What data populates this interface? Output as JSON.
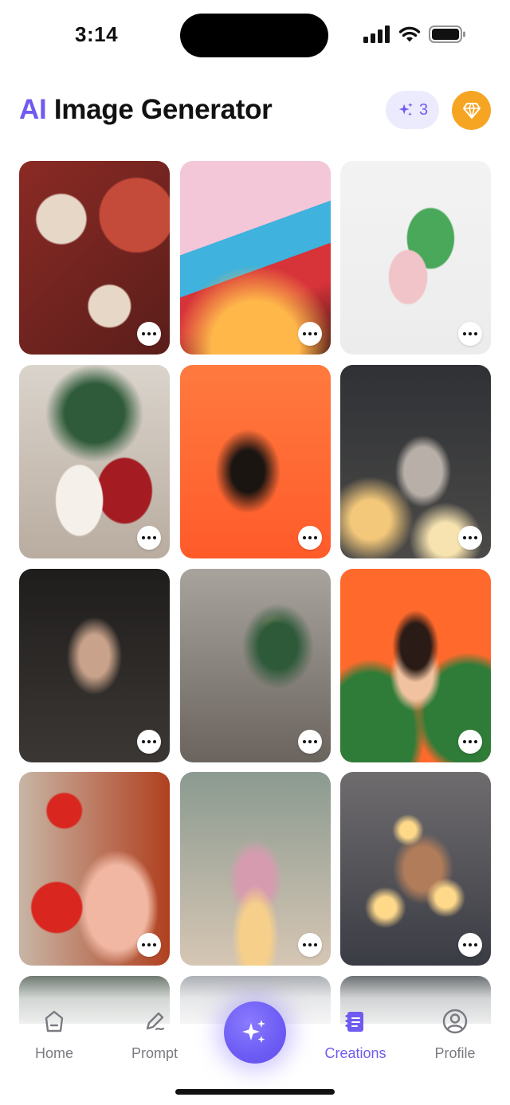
{
  "status_bar": {
    "time": "3:14"
  },
  "header": {
    "title_accent": "AI",
    "title_rest": " Image Generator",
    "credits": "3",
    "credit_icon": "sparkle-icon",
    "premium_icon": "diamond-icon"
  },
  "colors": {
    "accent": "#6f5bf0",
    "premium": "#f6a523",
    "credits_bg": "#ecebfd"
  },
  "grid": {
    "more_icon": "more-horizontal-icon",
    "tiles": [
      {
        "subject": "hygge-gift-box-flatlay",
        "palette": [
          "#8b2a25",
          "#c44a3a",
          "#e7d7c7"
        ]
      },
      {
        "subject": "sunset-street-film",
        "palette": [
          "#f3c6d8",
          "#3fb2dd",
          "#ffb74a"
        ]
      },
      {
        "subject": "green-robot-capsule",
        "palette": [
          "#ececec",
          "#49a85a",
          "#f0c4c8"
        ]
      },
      {
        "subject": "couple-by-christmas-tree",
        "palette": [
          "#dad4cc",
          "#a41c22",
          "#f5f1ea"
        ]
      },
      {
        "subject": "woman-orange-shadow",
        "palette": [
          "#ff7a3f",
          "#ff5b2a",
          "#1b1512"
        ]
      },
      {
        "subject": "woman-with-gift-bokeh",
        "palette": [
          "#2f3135",
          "#b8b0a8",
          "#f4c87a"
        ]
      },
      {
        "subject": "muscular-man-dark-room",
        "palette": [
          "#1f1d1c",
          "#3b3734",
          "#c8a28a"
        ]
      },
      {
        "subject": "family-christmas-living-room",
        "palette": [
          "#6b645e",
          "#a8a39d",
          "#e2c48a"
        ]
      },
      {
        "subject": "surprised-woman-orange",
        "palette": [
          "#ff6a2c",
          "#2f7b38",
          "#f1c2a0"
        ]
      },
      {
        "subject": "woman-with-heart-balloons",
        "palette": [
          "#b0401f",
          "#d9261f",
          "#f1b7a2"
        ]
      },
      {
        "subject": "girl-with-birthday-cake",
        "palette": [
          "#8b9a90",
          "#d6c6b4",
          "#f6cf8b"
        ]
      },
      {
        "subject": "woman-fairy-lights-beach",
        "palette": [
          "#3a3c44",
          "#6f6c6e",
          "#ffd98a"
        ]
      }
    ]
  },
  "tab_bar": {
    "tabs": [
      {
        "label": "Home",
        "icon": "home-icon"
      },
      {
        "label": "Prompt",
        "icon": "pen-icon"
      },
      {
        "label": "Creations",
        "icon": "creations-icon"
      },
      {
        "label": "Profile",
        "icon": "profile-icon"
      }
    ],
    "active": "Creations",
    "create_icon": "sparkle-icon"
  }
}
